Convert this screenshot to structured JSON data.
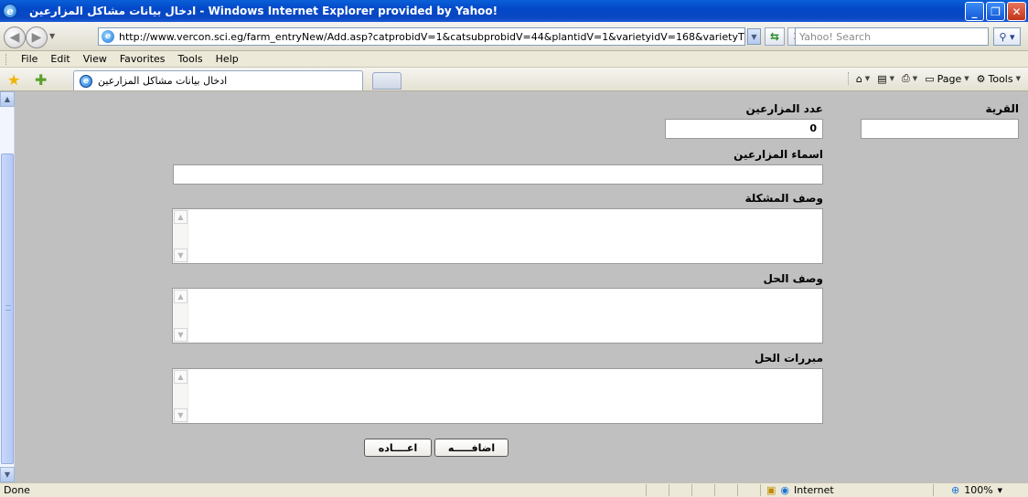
{
  "window": {
    "title": "ادخال بيانات مشاكل المزارعين - Windows Internet Explorer provided by Yahoo!",
    "buttons": [
      "_",
      "❐",
      "✕"
    ]
  },
  "addressbar": {
    "back_icon": "back-arrow-icon",
    "forward_icon": "forward-arrow-icon",
    "url": "http://www.vercon.sci.eg/farm_entryNew/Add.asp?catprobidV=1&catsubprobidV=44&plantidV=1&varietyidV=168&varietyT",
    "search_placeholder": "Yahoo! Search"
  },
  "menu": {
    "items": [
      "File",
      "Edit",
      "View",
      "Favorites",
      "Tools",
      "Help"
    ]
  },
  "favbar": {
    "tab_title": "ادخال بيانات مشاكل المزارعين",
    "page_label": "Page",
    "tools_label": "Tools"
  },
  "form": {
    "village_label": "القرية",
    "village_value": "",
    "farmers_count_label": "عدد المزارعين",
    "farmers_count_value": "0",
    "farmers_names_label": "اسماء المزارعين",
    "farmers_names_value": "",
    "problem_desc_label": "وصف المشكلة",
    "solution_desc_label": "وصف الحل",
    "solution_reasons_label": "مبررات الحل",
    "add_button": "اضافـــــه",
    "reset_button": "اعــــاده"
  },
  "status": {
    "text": "Done",
    "zone": "Internet",
    "zoom": "100%"
  },
  "colors": {
    "titlebar": "#0348c9",
    "content_bg": "#c0c0c0",
    "chrome_bg": "#ece9d8"
  }
}
